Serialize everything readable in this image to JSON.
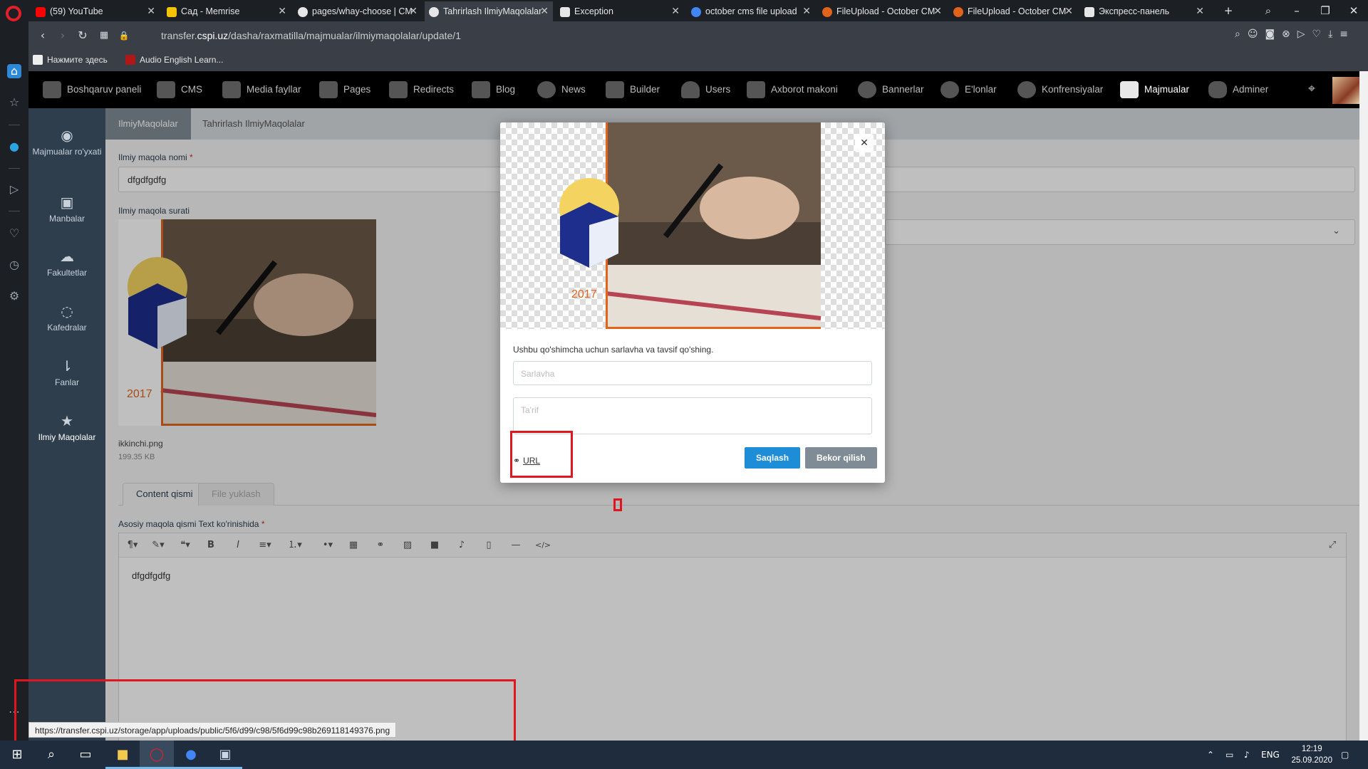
{
  "browser": {
    "tabs": [
      {
        "title": "(59) YouTube",
        "color": "#ff0000",
        "active": false
      },
      {
        "title": "Сад - Memrise",
        "color": "#f5c400",
        "active": false
      },
      {
        "title": "pages/whay-choose | CM",
        "color": "#ffffff",
        "active": false
      },
      {
        "title": "Tahrirlash IlmiyMaqolalar",
        "color": "#ffffff",
        "active": true
      },
      {
        "title": "Exception",
        "color": "#ffffff",
        "active": false
      },
      {
        "title": "october cms file upload",
        "color": "#4285f4",
        "active": false
      },
      {
        "title": "FileUpload - October CM",
        "color": "#e0641c",
        "active": false
      },
      {
        "title": "FileUpload - October CM",
        "color": "#e0641c",
        "active": false
      },
      {
        "title": "Экспресс-панель",
        "color": "#ffffff",
        "active": false
      }
    ],
    "url_prefix": "transfer.",
    "url_domain": "cspi.uz",
    "url_path": "/dasha/raxmatilla/majmualar/ilmiymaqolalar/update/1",
    "bookmarks": [
      "Нажмите здесь",
      "Audio English Learn..."
    ],
    "status_url": "https://transfer.cspi.uz/storage/app/uploads/public/5f6/d99/c98/5f6d99c98b269118149376.png"
  },
  "cms_nav": {
    "items": [
      "Boshqaruv paneli",
      "CMS",
      "Media fayllar",
      "Pages",
      "Redirects",
      "Blog",
      "News",
      "Builder",
      "Users",
      "Axborot makoni",
      "Bannerlar",
      "E'lonlar",
      "Konfrensiyalar",
      "Majmualar",
      "Adminer"
    ],
    "active": "Majmualar"
  },
  "side_menu": {
    "items": [
      {
        "label": "Majmualar ro'yxati",
        "icon": "spotify-icon"
      },
      {
        "label": "Manbalar",
        "icon": "briefcase-icon"
      },
      {
        "label": "Fakultetlar",
        "icon": "chat-icon"
      },
      {
        "label": "Kafedralar",
        "icon": "weibo-icon"
      },
      {
        "label": "Fanlar",
        "icon": "sort-icon"
      },
      {
        "label": "Ilmiy Maqolalar",
        "icon": "star-icon"
      }
    ],
    "active": "Ilmiy Maqolalar"
  },
  "breadcrumb": {
    "parent": "IlmiyMaqolalar",
    "current": "Tahrirlash IlmiyMaqolalar"
  },
  "form": {
    "name_label": "Ilmiy maqola nomi",
    "name_value": "dfgdfgdfg",
    "image_label": "Ilmiy maqola surati",
    "file_name": "ikkinchi.png",
    "file_size": "199.35 KB",
    "image_year": "2017",
    "tabs": [
      "Content qismi",
      "File yuklash"
    ],
    "body_label": "Asosiy maqola qismi Text ko'rinishida",
    "body_text": "dfgdfgdfg",
    "required_mark": "*"
  },
  "modal": {
    "image_year": "2017",
    "description": "Ushbu qo'shimcha uchun sarlavha va tavsif qo'shing.",
    "title_placeholder": "Sarlavha",
    "desc_placeholder": "Ta'rif",
    "url_label": "URL",
    "save_label": "Saqlash",
    "cancel_label": "Bekor qilish"
  },
  "taskbar": {
    "language": "ENG",
    "time": "12:19",
    "date": "25.09.2020"
  },
  "colors": {
    "accent": "#1d8dd8",
    "annotation_red": "#e0161e",
    "sidebar": "#2f3e4d"
  }
}
